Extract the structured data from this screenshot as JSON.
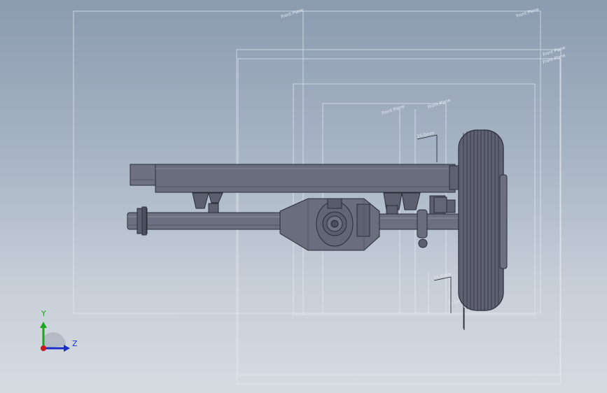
{
  "viewport": {
    "background_top": "#8b9bb0",
    "background_bottom": "#d6dbe1"
  },
  "annotations": {
    "plane_1": "Front Plane",
    "plane_2": "Front Plane",
    "plane_3": "Front Plane",
    "plane_4": "Front Plane",
    "plane_5": "Front Plane",
    "plane_6": "Front Plane",
    "dim_1": "15.0mm",
    "dim_2": "15.0mm",
    "dim_3": "15.0mm"
  },
  "triad": {
    "y_label": "Y",
    "z_label": "Z",
    "y_color": "#18a818",
    "z_color": "#1a2ec8",
    "x_color": "#c81818"
  },
  "icons": {
    "triad": "view-orientation-triad-icon"
  }
}
